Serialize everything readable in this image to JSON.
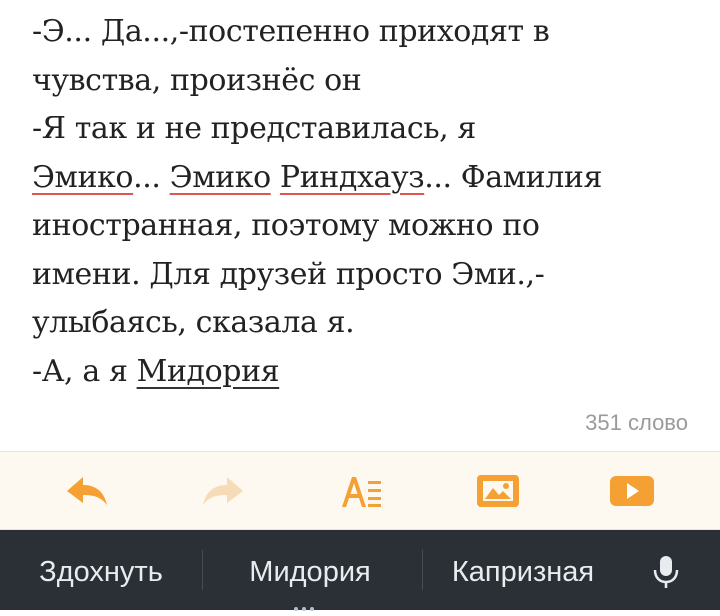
{
  "document": {
    "lines": [
      {
        "segments": [
          {
            "text": "-Э... Да...,-постепенно приходят в",
            "style": "plain"
          }
        ]
      },
      {
        "segments": [
          {
            "text": "чувства, произнёс он",
            "style": "plain"
          }
        ]
      },
      {
        "segments": [
          {
            "text": "-Я так и не представилась, я",
            "style": "plain"
          }
        ]
      },
      {
        "segments": [
          {
            "text": "Эмико",
            "style": "spell"
          },
          {
            "text": "... ",
            "style": "plain"
          },
          {
            "text": "Эмико",
            "style": "spell"
          },
          {
            "text": " ",
            "style": "plain"
          },
          {
            "text": "Риндхауз",
            "style": "spell"
          },
          {
            "text": "... Фамилия",
            "style": "plain"
          }
        ]
      },
      {
        "segments": [
          {
            "text": "иностранная, поэтому можно по",
            "style": "plain"
          }
        ]
      },
      {
        "segments": [
          {
            "text": "имени. Для друзей просто Эми.,-",
            "style": "plain"
          }
        ]
      },
      {
        "segments": [
          {
            "text": "улыбаясь, сказала я.",
            "style": "plain"
          }
        ]
      },
      {
        "segments": [
          {
            "text": "-А, а я ",
            "style": "plain"
          },
          {
            "text": "Мидория",
            "style": "underline"
          }
        ]
      }
    ],
    "word_count": "351 слово"
  },
  "toolbar": {
    "accent_color": "#f5a033",
    "disabled_color": "#f6dcb6",
    "buttons": [
      {
        "name": "undo-button",
        "icon": "undo-arrow-icon",
        "enabled": true
      },
      {
        "name": "redo-button",
        "icon": "redo-arrow-icon",
        "enabled": false
      },
      {
        "name": "text-format-button",
        "icon": "text-format-icon",
        "enabled": true
      },
      {
        "name": "insert-image-button",
        "icon": "image-icon",
        "enabled": true
      },
      {
        "name": "insert-video-button",
        "icon": "video-play-icon",
        "enabled": true
      }
    ]
  },
  "keyboard": {
    "background": "#2b3036",
    "suggestions": [
      "Здохнуть",
      "Мидория",
      "Капризная"
    ],
    "mic_icon": "microphone-icon"
  }
}
